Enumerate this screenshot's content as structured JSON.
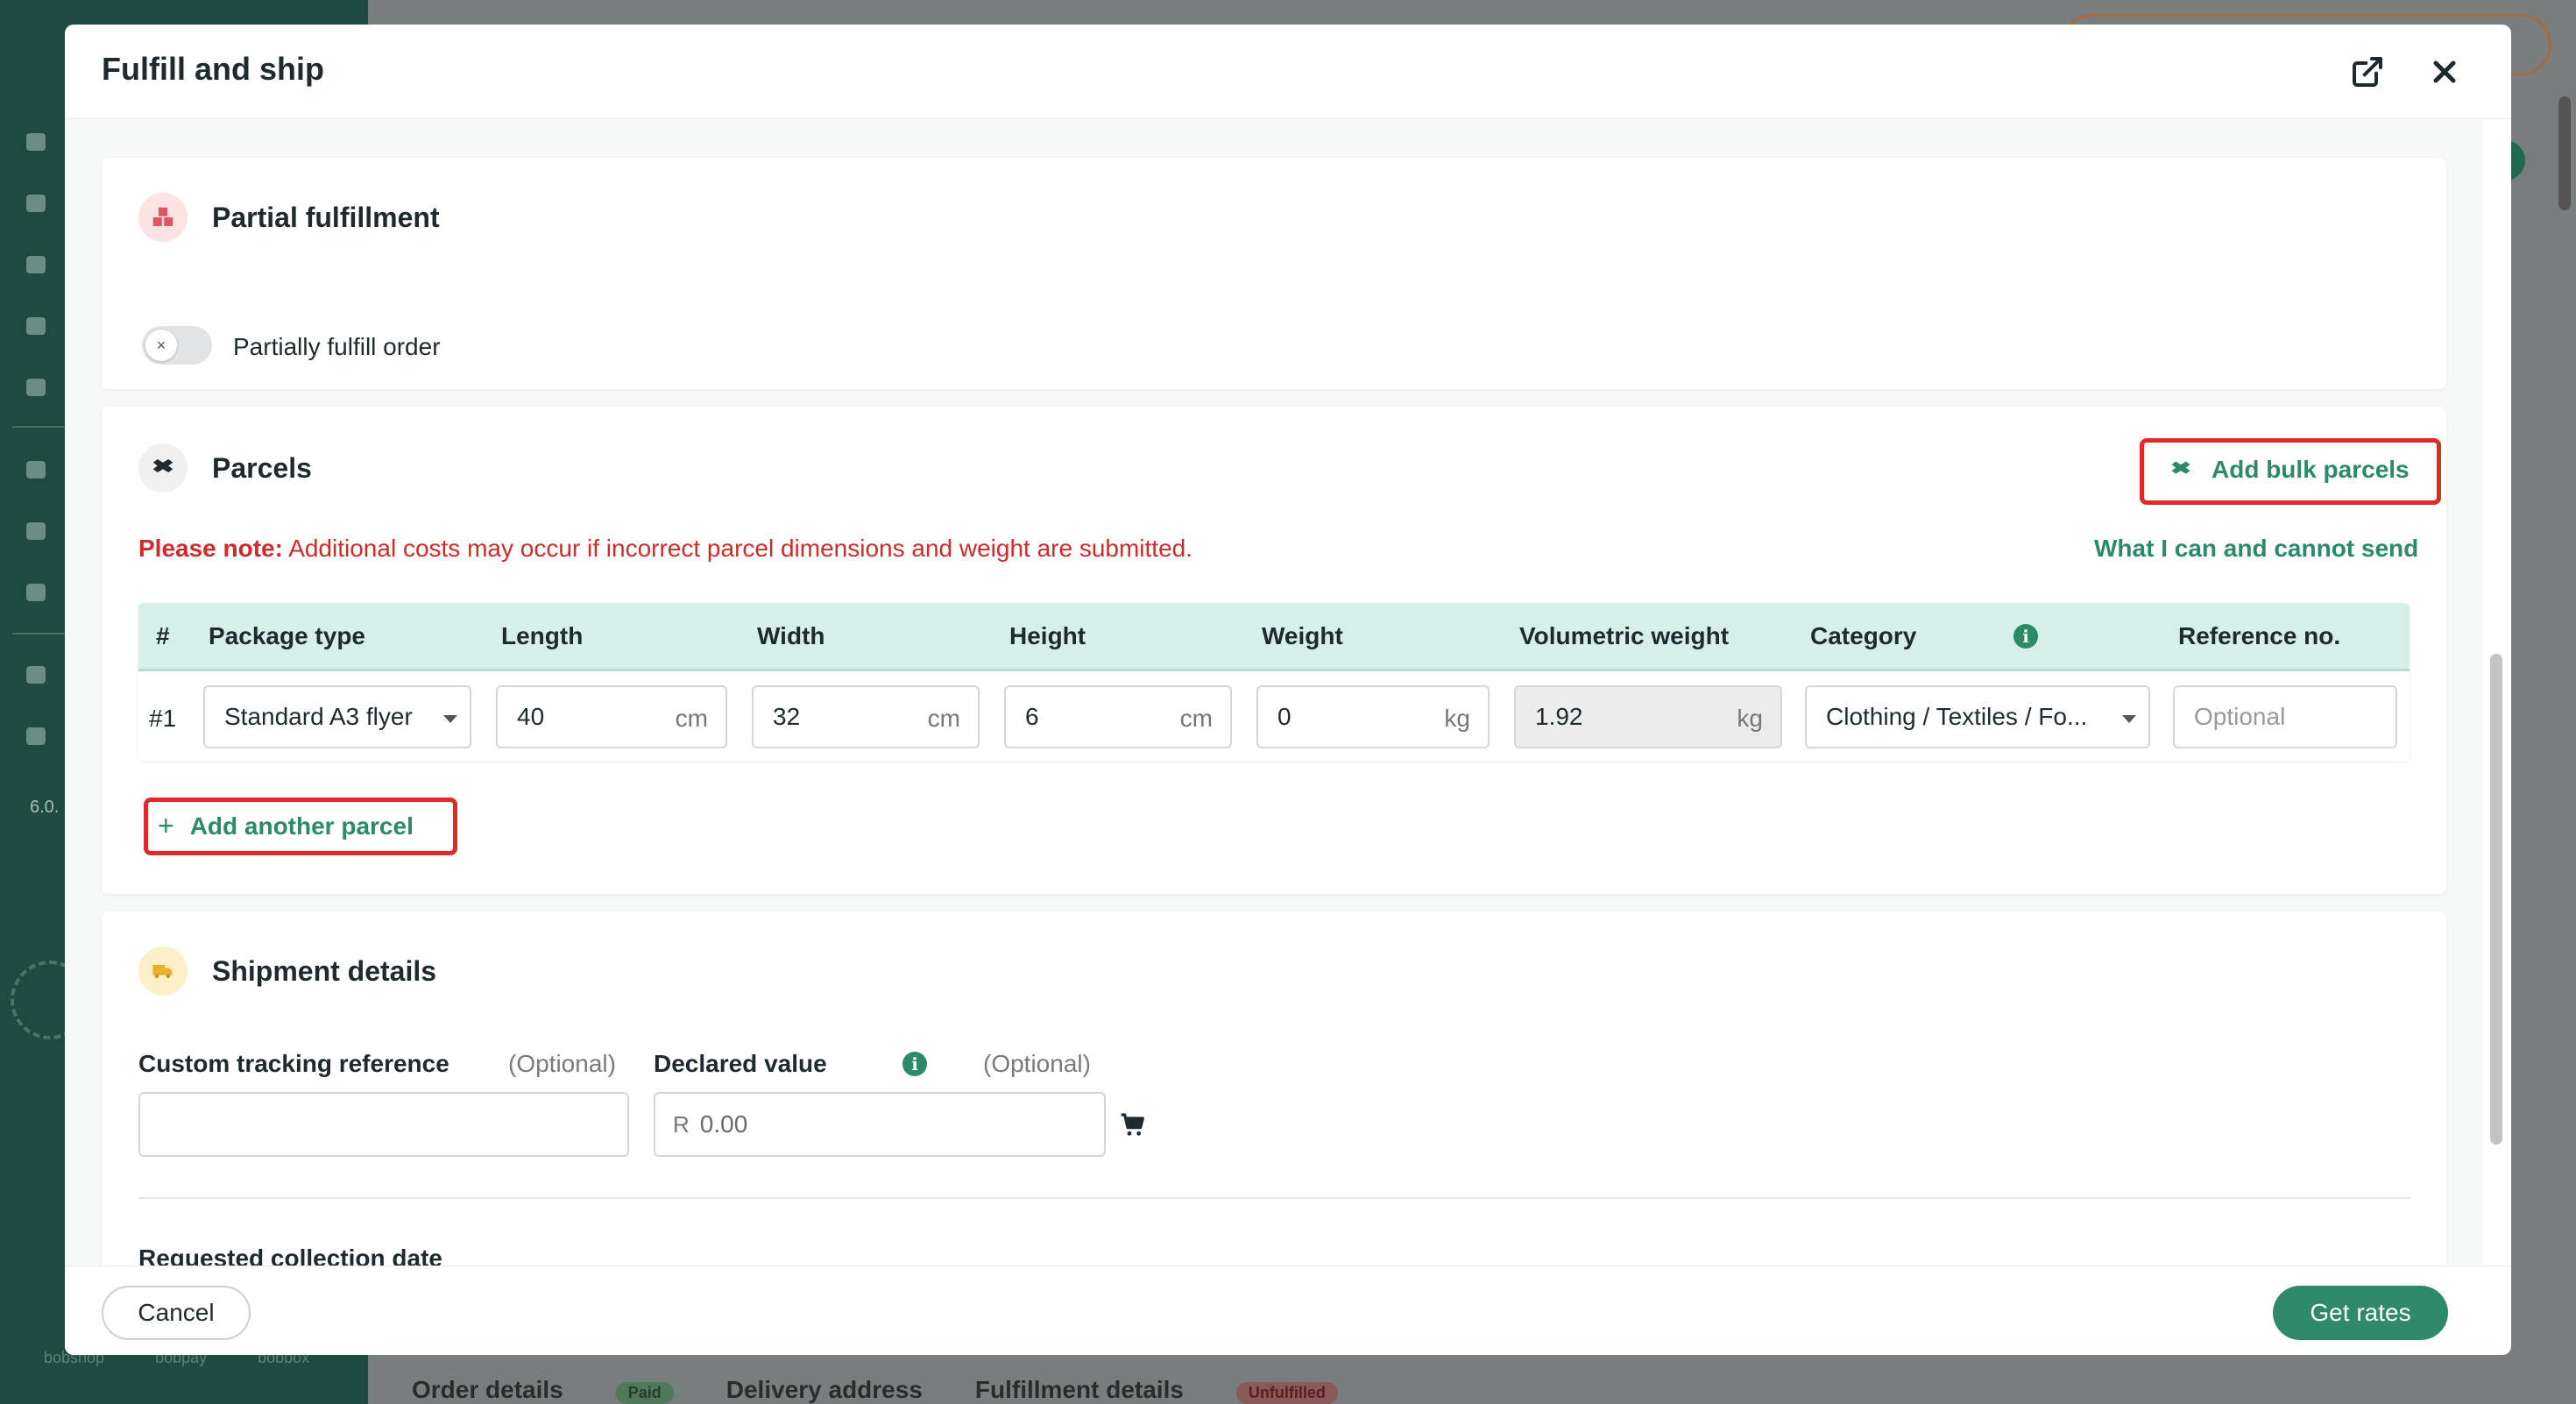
{
  "modal": {
    "title": "Fulfill and ship"
  },
  "partial": {
    "title": "Partial fulfillment",
    "toggle_label": "Partially fulfill order",
    "toggle_on": false
  },
  "parcels": {
    "title": "Parcels",
    "add_bulk_label": "Add bulk parcels",
    "note_strong": "Please note:",
    "note_text": "Additional costs may occur if incorrect parcel dimensions and weight are submitted.",
    "what_link": "What I can and cannot send",
    "columns": [
      "#",
      "Package type",
      "Length",
      "Width",
      "Height",
      "Weight",
      "Volumetric weight",
      "Category",
      "Reference no."
    ],
    "rows": [
      {
        "num": "#1",
        "package_type": "Standard A3 flyer",
        "length": "40",
        "length_unit": "cm",
        "width": "32",
        "width_unit": "cm",
        "height": "6",
        "height_unit": "cm",
        "weight": "0",
        "weight_unit": "kg",
        "volumetric": "1.92",
        "volumetric_unit": "kg",
        "category": "Clothing / Textiles / Fo...",
        "reference_placeholder": "Optional"
      }
    ],
    "add_another_label": "Add another parcel"
  },
  "shipment": {
    "title": "Shipment details",
    "tracking_label": "Custom tracking reference",
    "tracking_optional": "(Optional)",
    "tracking_value": "",
    "declared_label": "Declared value",
    "declared_optional": "(Optional)",
    "declared_prefix": "R",
    "declared_value": "0.00",
    "collection_label": "Requested collection date"
  },
  "footer": {
    "cancel_label": "Cancel",
    "primary_label": "Get rates"
  },
  "background": {
    "version": "6.0.",
    "logos": [
      "bobshop",
      "bobpay",
      "bobbox"
    ],
    "bottom_titles": [
      "Order details",
      "Paid",
      "Delivery address",
      "Fulfillment details",
      "Unfulfilled"
    ]
  },
  "colors": {
    "accent": "#2c8a68",
    "primary_button": "#2f8a6b",
    "warning": "#d02b2b",
    "table_header": "#d6efe8",
    "highlight": "#e02a2a"
  }
}
